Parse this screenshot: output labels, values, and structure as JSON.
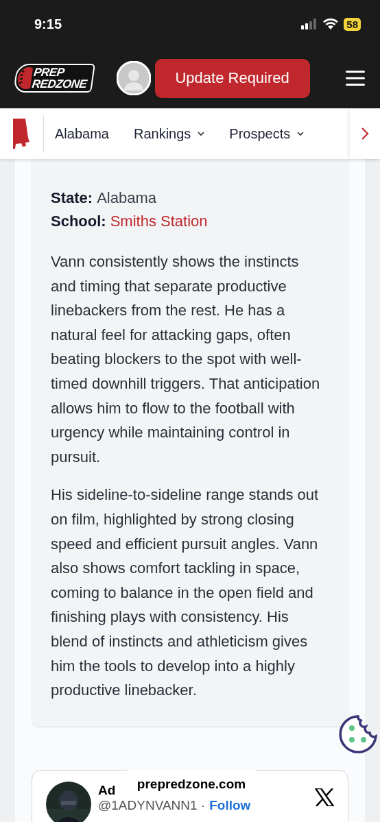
{
  "status_bar": {
    "time": "9:15",
    "battery": "58"
  },
  "header": {
    "logo_top": "PREP",
    "logo_bottom": "REDZONE",
    "update_button": "Update Required"
  },
  "nav": {
    "items": [
      {
        "label": "Alabama",
        "dropdown": false
      },
      {
        "label": "Rankings",
        "dropdown": true
      },
      {
        "label": "Prospects",
        "dropdown": true
      }
    ]
  },
  "profile": {
    "fields": [
      {
        "label": "State:",
        "value": "Alabama",
        "kind": "plain"
      },
      {
        "label": "School:",
        "value": "Smiths Station",
        "kind": "link"
      }
    ],
    "paragraphs": [
      "Vann consistently shows the instincts and timing that separate productive linebackers from the rest. He has a natural feel for attacking gaps, often beating blockers to the spot with well-timed downhill triggers. That anticipation allows him to flow to the football with urgency while maintaining control in pursuit.",
      "His sideline-to-sideline range stands out on film, highlighted by strong closing speed and efficient pursuit angles. Vann also shows comfort tackling in space, coming to balance in the open field and finishing plays with consistency. His blend of instincts and athleticism gives him the tools to develop into a highly productive linebacker."
    ]
  },
  "tweet": {
    "name": "Ad",
    "handle": "@1ADYNVANN1 ·",
    "follow": "Follow"
  },
  "url_pill": "prepredzone.com"
}
